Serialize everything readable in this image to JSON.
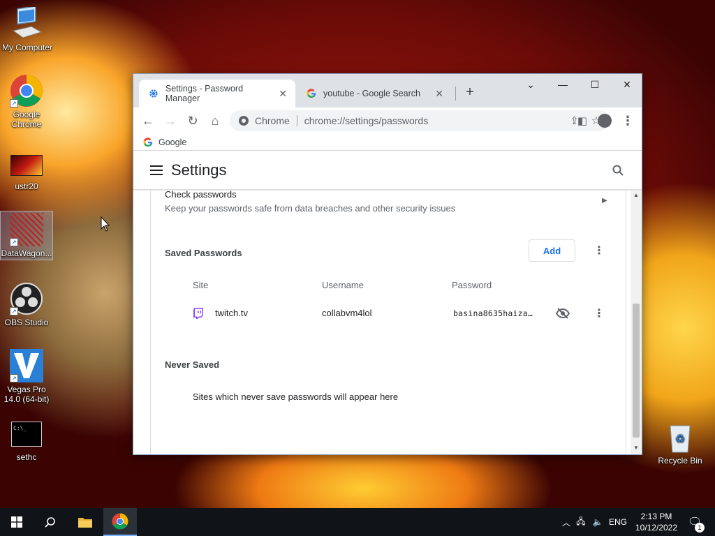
{
  "desktop": {
    "icons": [
      {
        "label": "My Computer"
      },
      {
        "label": "Google Chrome"
      },
      {
        "label": "ustr20"
      },
      {
        "label": "DataWagon..."
      },
      {
        "label": "OBS Studio"
      },
      {
        "label": "Vegas Pro 14.0 (64-bit)"
      },
      {
        "label": "sethc"
      },
      {
        "label": "Recycle Bin"
      }
    ]
  },
  "browser": {
    "tabs": [
      {
        "title": "Settings - Password Manager",
        "icon": "gear-icon",
        "active": true
      },
      {
        "title": "youtube - Google Search",
        "icon": "google-icon",
        "active": false
      }
    ],
    "omnibox": {
      "chip": "Chrome",
      "url": "chrome://settings/passwords"
    },
    "bookmarks": [
      {
        "label": "Google"
      }
    ]
  },
  "settings": {
    "title": "Settings",
    "check_passwords": {
      "title": "Check passwords",
      "subtitle": "Keep your passwords safe from data breaches and other security issues"
    },
    "saved_passwords": {
      "heading": "Saved Passwords",
      "add_label": "Add",
      "columns": [
        "Site",
        "Username",
        "Password"
      ],
      "rows": [
        {
          "site": "twitch.tv",
          "username": "collabvm4lol",
          "password": "basina8635haiza…"
        }
      ]
    },
    "never_saved": {
      "heading": "Never Saved",
      "empty_text": "Sites which never save passwords will appear here"
    }
  },
  "taskbar": {
    "language": "ENG",
    "time": "2:13 PM",
    "date": "10/12/2022",
    "notification_count": "1"
  }
}
